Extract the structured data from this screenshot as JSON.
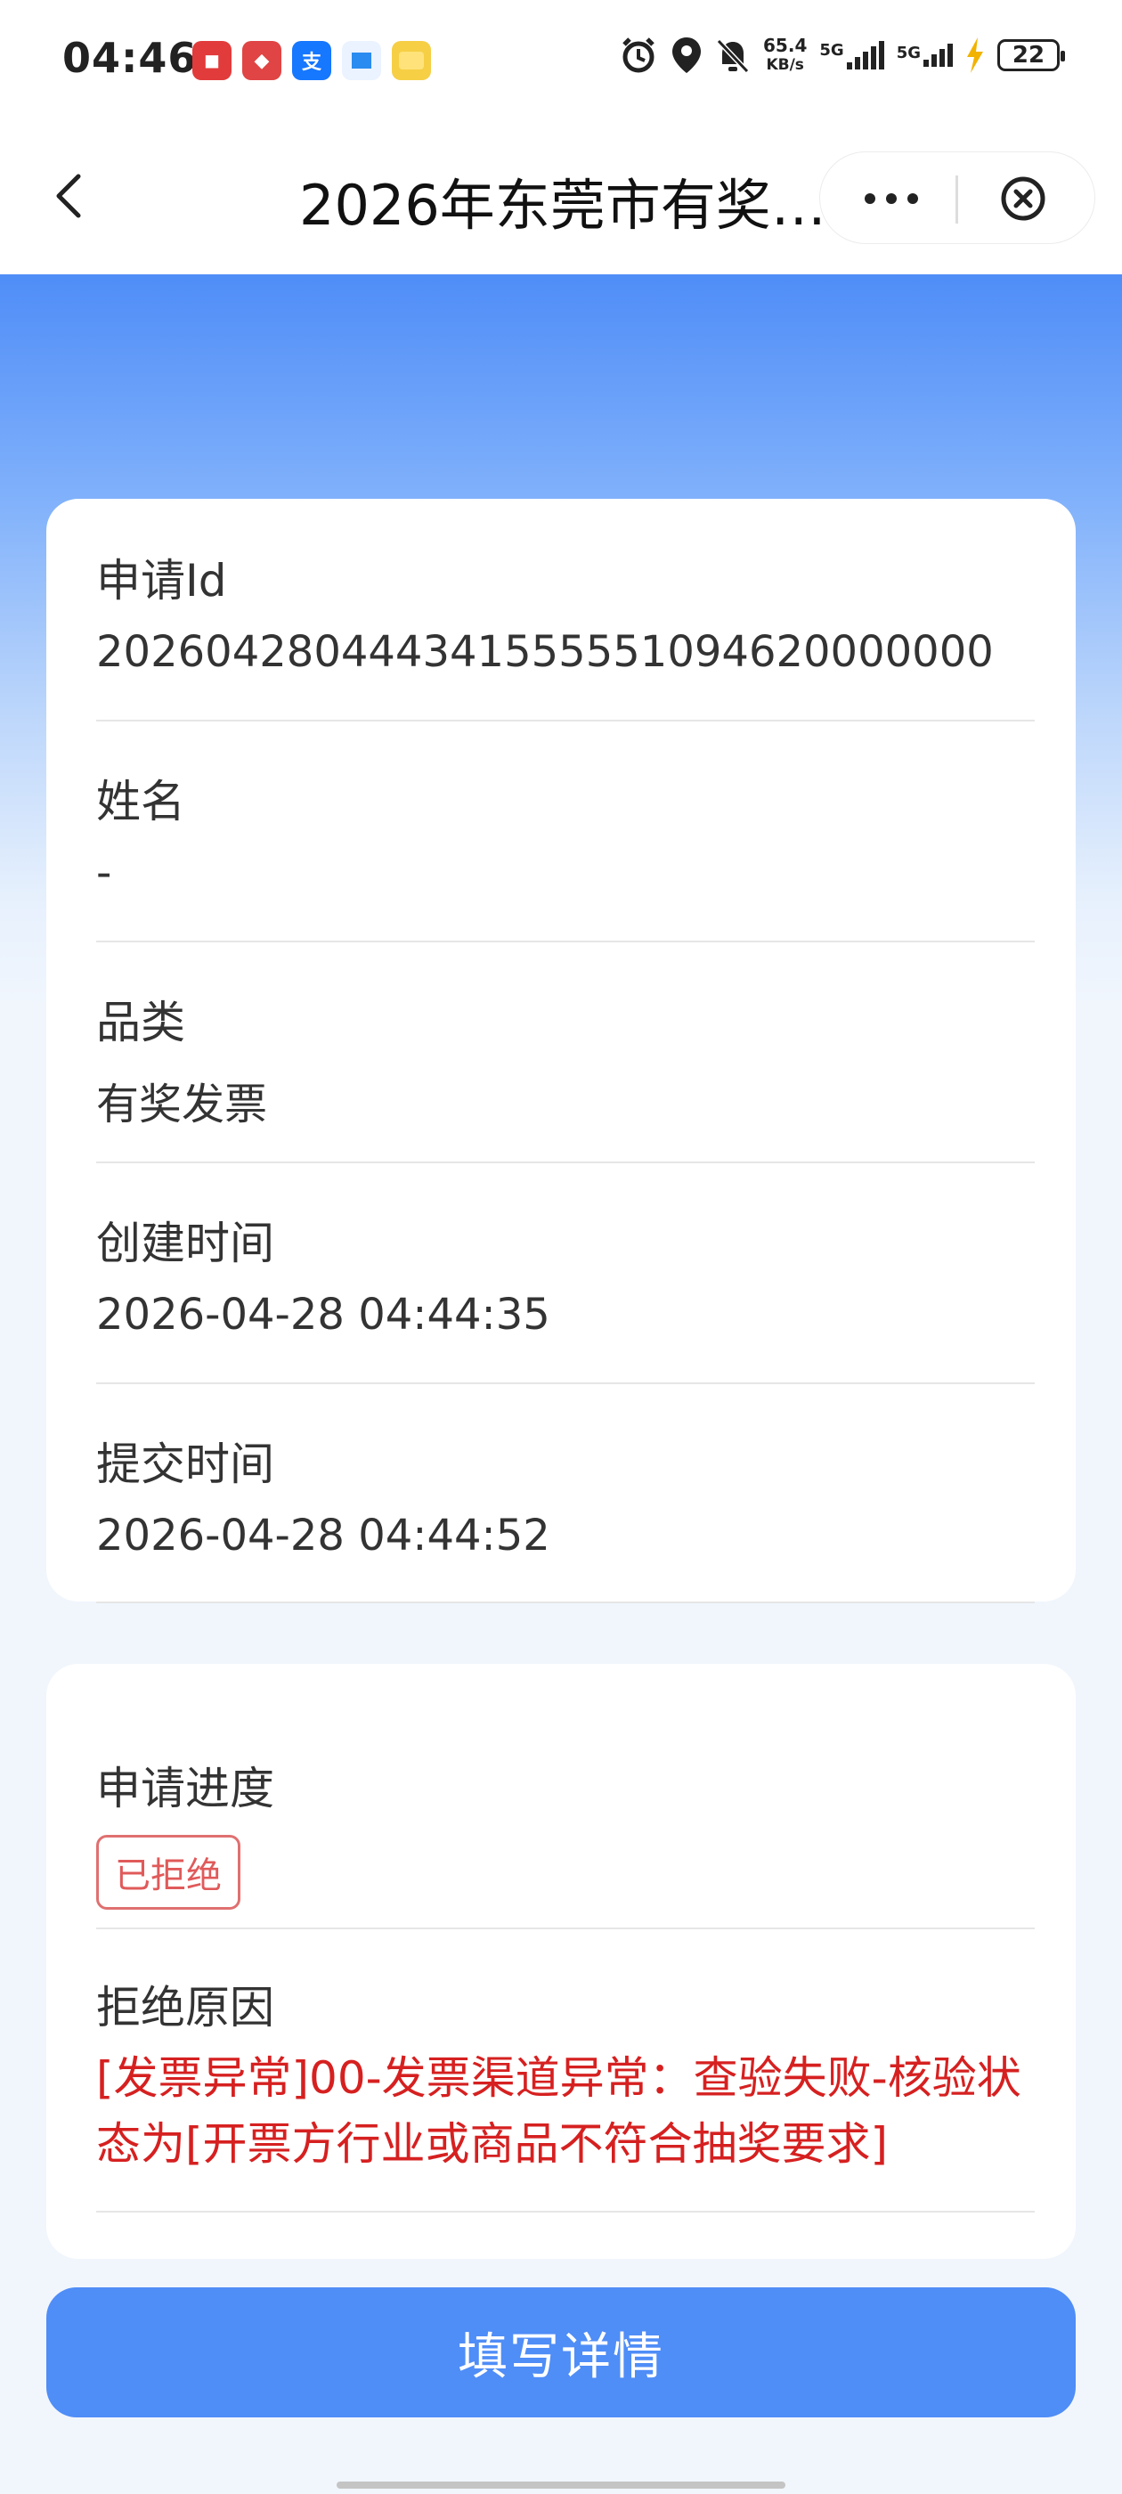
{
  "status_bar": {
    "time": "04:46",
    "net_speed_value": "65.4",
    "net_speed_unit": "KB/s",
    "sim1_label": "5G",
    "sim2_label": "5G",
    "battery": "22"
  },
  "nav": {
    "title": "2026年东莞市有奖…"
  },
  "info": {
    "apply_id_label": "申请Id",
    "apply_id_value": "202604280444341555551094620000000",
    "name_label": "姓名",
    "name_value": "-",
    "category_label": "品类",
    "category_value": "有奖发票",
    "created_label": "创建时间",
    "created_value": "2026-04-28 04:44:35",
    "submitted_label": "提交时间",
    "submitted_value": "2026-04-28 04:44:52"
  },
  "progress": {
    "progress_label": "申请进度",
    "status_tag": "已拒绝",
    "reason_label": "拒绝原因",
    "reason_text": "[发票异常]00-发票渠道异常：查验失败-核验状态为[开票方行业或商品不符合抽奖要求]"
  },
  "actions": {
    "fill_details": "填写详情"
  },
  "colors": {
    "primary": "#4f8df7",
    "reject_red": "#d62020",
    "tag_border": "#e07070"
  },
  "icons": [
    "back-chevron-icon",
    "more-dots-icon",
    "close-circle-icon",
    "alarm-icon",
    "location-icon",
    "mute-bell-icon",
    "charging-icon"
  ]
}
